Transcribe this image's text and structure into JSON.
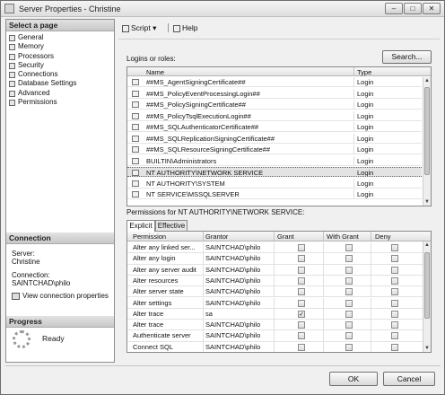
{
  "window": {
    "title": "Server Properties - Christine",
    "minimize_glyph": "–",
    "maximize_glyph": "□",
    "close_glyph": "✕"
  },
  "left_pane": {
    "select_page_header": "Select a page",
    "pages": [
      {
        "label": "General",
        "icon": "page-icon"
      },
      {
        "label": "Memory",
        "icon": "page-icon"
      },
      {
        "label": "Processors",
        "icon": "page-icon"
      },
      {
        "label": "Security",
        "icon": "page-icon"
      },
      {
        "label": "Connections",
        "icon": "page-icon"
      },
      {
        "label": "Database Settings",
        "icon": "page-icon"
      },
      {
        "label": "Advanced",
        "icon": "page-icon"
      },
      {
        "label": "Permissions",
        "icon": "page-icon"
      }
    ],
    "connection_header": "Connection",
    "server_label": "Server:",
    "server_value": "Christine",
    "connection_label": "Connection:",
    "connection_value": "SAINTCHAD\\philo",
    "view_connection_properties": "View connection properties",
    "progress_header": "Progress",
    "progress_status": "Ready"
  },
  "toolbar": {
    "script_label": "Script",
    "script_dropdown": "▾",
    "help_label": "Help"
  },
  "logins": {
    "label": "Logins or roles:",
    "search_button": "Search...",
    "columns": [
      "Name",
      "Type"
    ],
    "rows": [
      {
        "name": "##MS_AgentSigningCertificate##",
        "type": "Login"
      },
      {
        "name": "##MS_PolicyEventProcessingLogin##",
        "type": "Login"
      },
      {
        "name": "##MS_PolicySigningCertificate##",
        "type": "Login"
      },
      {
        "name": "##MS_PolicyTsqlExecutionLogin##",
        "type": "Login"
      },
      {
        "name": "##MS_SQLAuthenticatorCertificate##",
        "type": "Login"
      },
      {
        "name": "##MS_SQLReplicationSigningCertificate##",
        "type": "Login"
      },
      {
        "name": "##MS_SQLResourceSigningCertificate##",
        "type": "Login"
      },
      {
        "name": "BUILTIN\\Administrators",
        "type": "Login"
      },
      {
        "name": "NT AUTHORITY\\NETWORK SERVICE",
        "type": "Login",
        "selected": true
      },
      {
        "name": "NT AUTHORITY\\SYSTEM",
        "type": "Login"
      },
      {
        "name": "NT SERVICE\\MSSQLSERVER",
        "type": "Login"
      }
    ]
  },
  "permissions": {
    "label": "Permissions for NT AUTHORITY\\NETWORK SERVICE:",
    "tabs": [
      {
        "label": "Explicit",
        "active": true
      },
      {
        "label": "Effective",
        "active": false
      }
    ],
    "columns": [
      "Permission",
      "Grantor",
      "Grant",
      "With Grant",
      "Deny"
    ],
    "rows": [
      {
        "permission": "Alter any linked ser...",
        "grantor": "SAINTCHAD\\philo",
        "grant": false,
        "with_grant": false,
        "deny": false
      },
      {
        "permission": "Alter any login",
        "grantor": "SAINTCHAD\\philo",
        "grant": false,
        "with_grant": false,
        "deny": false
      },
      {
        "permission": "Alter any server audit",
        "grantor": "SAINTCHAD\\philo",
        "grant": false,
        "with_grant": false,
        "deny": false
      },
      {
        "permission": "Alter resources",
        "grantor": "SAINTCHAD\\philo",
        "grant": false,
        "with_grant": false,
        "deny": false
      },
      {
        "permission": "Alter server state",
        "grantor": "SAINTCHAD\\philo",
        "grant": false,
        "with_grant": false,
        "deny": false
      },
      {
        "permission": "Alter settings",
        "grantor": "SAINTCHAD\\philo",
        "grant": false,
        "with_grant": false,
        "deny": false
      },
      {
        "permission": "Alter trace",
        "grantor": "sa",
        "grant": true,
        "with_grant": false,
        "deny": false
      },
      {
        "permission": "Alter trace",
        "grantor": "SAINTCHAD\\philo",
        "grant": false,
        "with_grant": false,
        "deny": false
      },
      {
        "permission": "Authenticate server",
        "grantor": "SAINTCHAD\\philo",
        "grant": false,
        "with_grant": false,
        "deny": false
      },
      {
        "permission": "Connect SQL",
        "grantor": "SAINTCHAD\\philo",
        "grant": false,
        "with_grant": false,
        "deny": false
      }
    ],
    "check_glyph": "✓"
  },
  "buttons": {
    "ok": "OK",
    "cancel": "Cancel"
  },
  "colors": {
    "header_gradient_top": "#e2e2e2",
    "selected_row": "#e3e3e3"
  }
}
